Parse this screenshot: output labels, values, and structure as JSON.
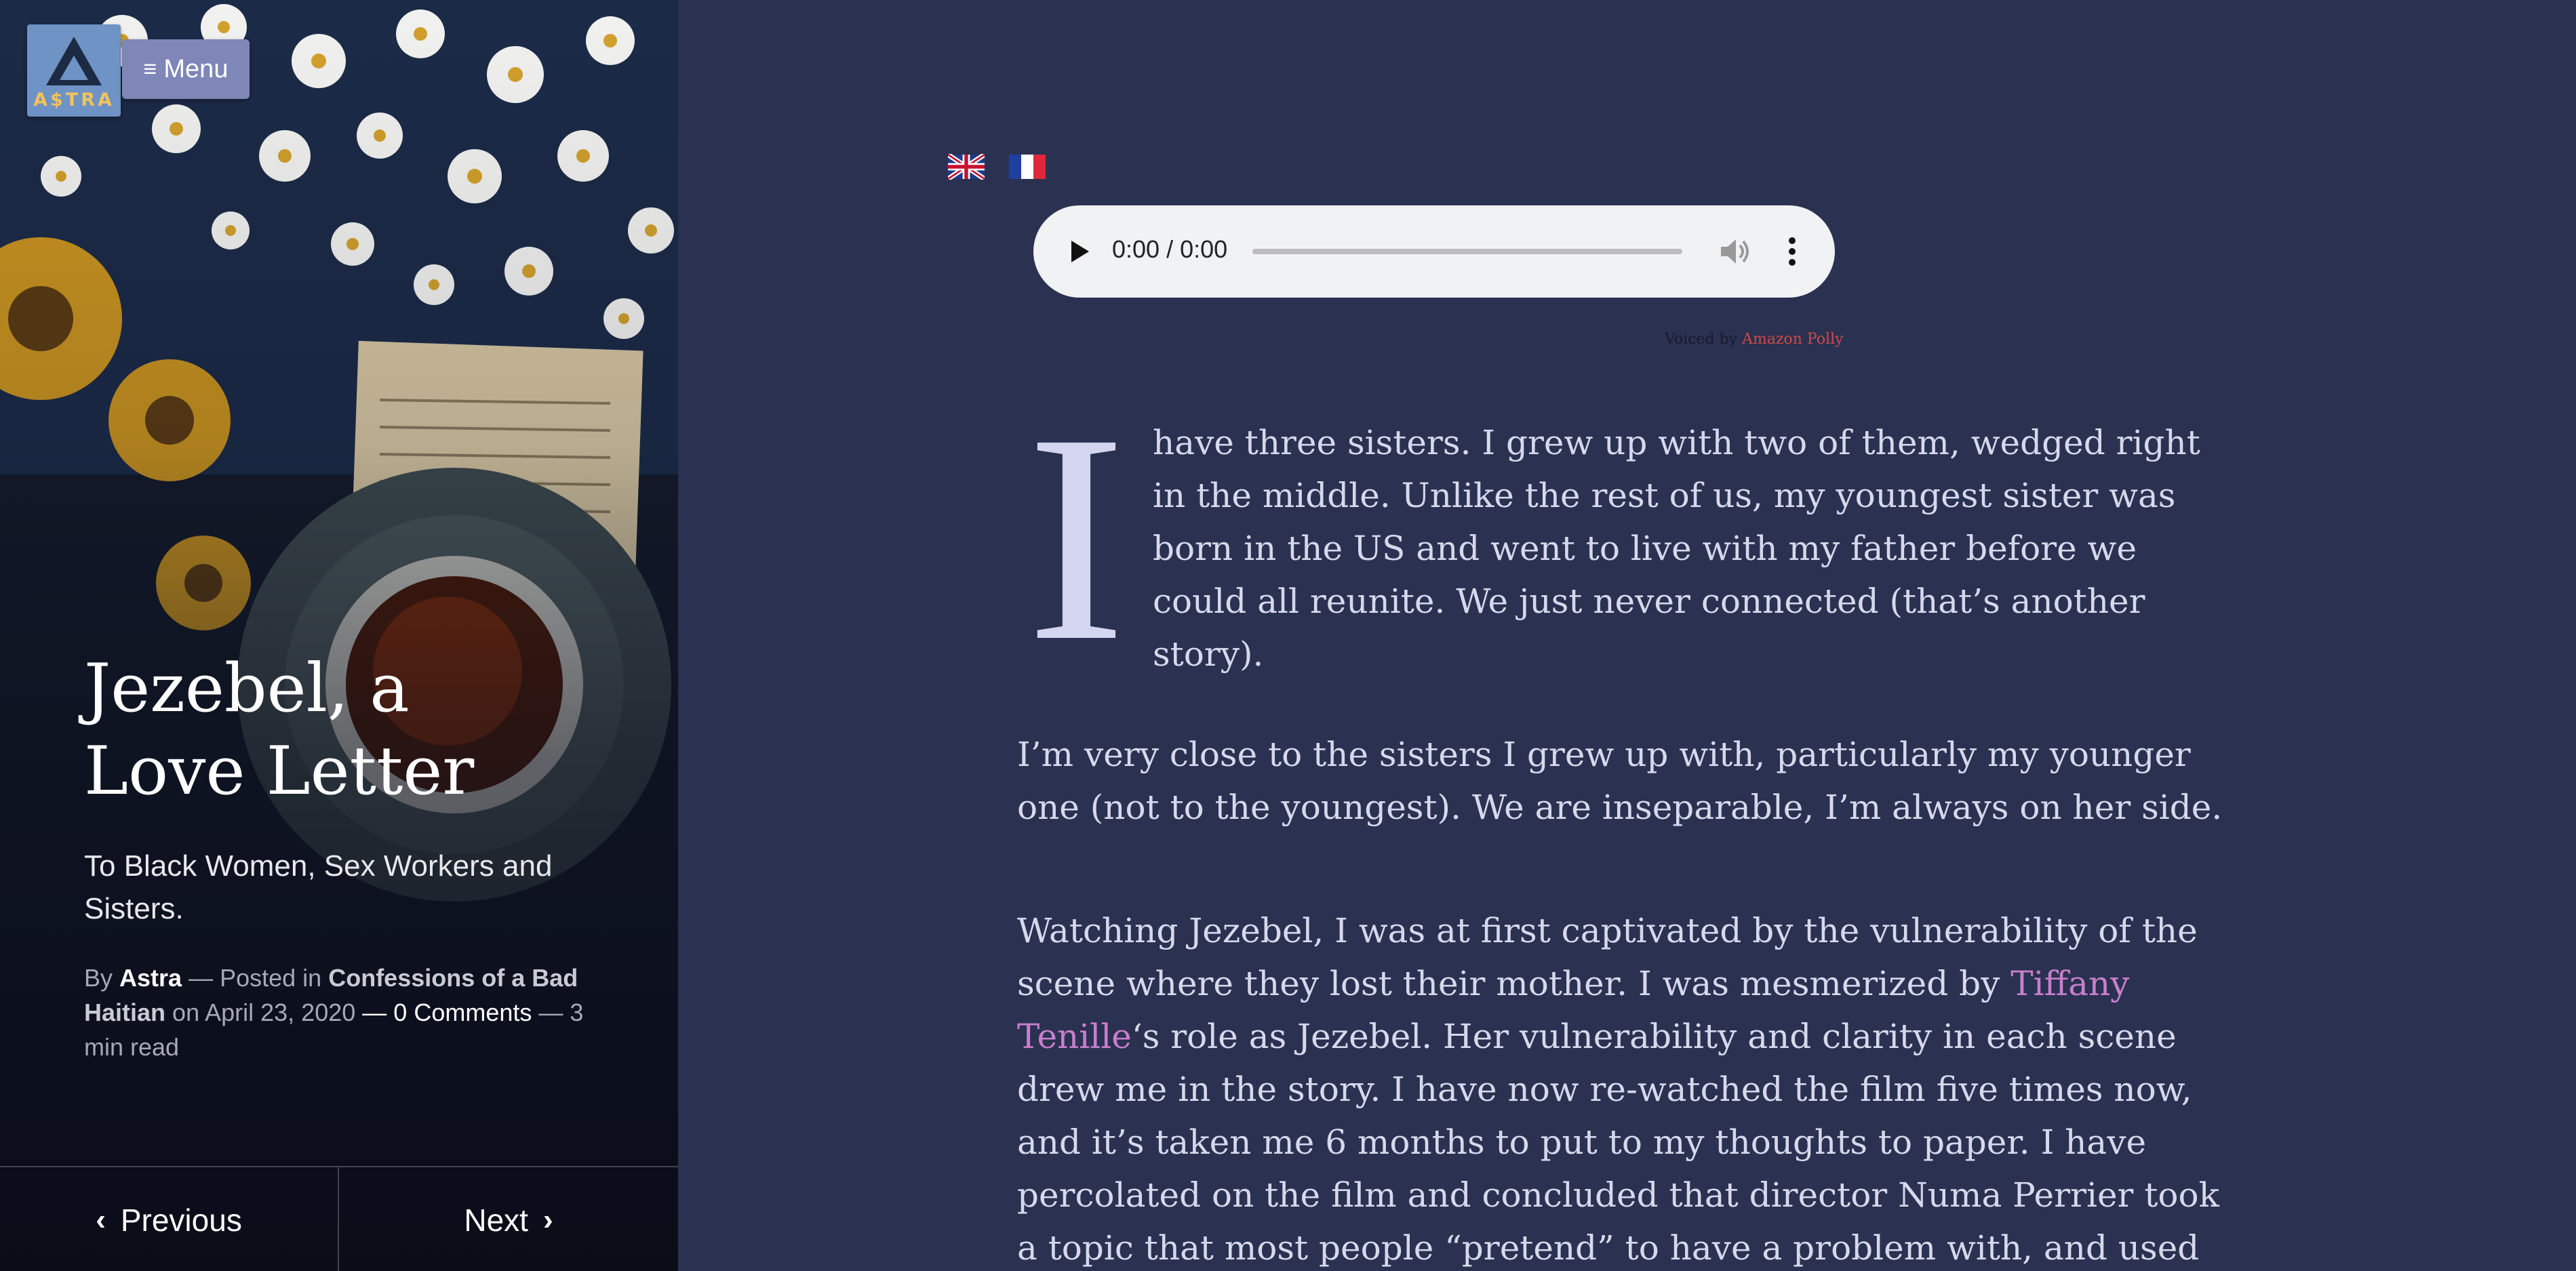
{
  "header": {
    "logo_text": "A$TRA",
    "menu_label": "Menu"
  },
  "post": {
    "title": "Jezebel, a Love Letter",
    "subtitle": "To Black Women, Sex Workers and Sisters.",
    "meta": {
      "by_label": "By",
      "author": "Astra",
      "posted_in_label": "— Posted in",
      "category": "Confessions of a Bad Haitian",
      "on_label": "on",
      "date": "April 23, 2020",
      "sep1": "—",
      "comments": "0 Comments",
      "sep2": "—",
      "read_time": "3 min read"
    }
  },
  "post_nav": {
    "previous_label": "Previous",
    "next_label": "Next"
  },
  "audio_player": {
    "time": "0:00 / 0:00",
    "voiced_by_label": "Voiced by",
    "voiced_by_service": "Amazon Polly"
  },
  "article": {
    "dropcap": "I",
    "p1": "have three sisters. I grew up with two of them, wedged right in the middle. Unlike the rest of us, my youngest sister was born in the US and went to live with my father before we could all reunite. We just never connected (that’s another story).",
    "p2": "I’m very close to the sisters I grew up with, particularly my younger one (not to the youngest).  We are inseparable, I’m always on her side.",
    "p3_before_link": "Watching Jezebel, I was at first captivated by the vulnerability of the scene where they lost their mother. I was mesmerized by ",
    "p3_link": "Tiffany Tenille",
    "p3_after_link": "‘s role as Jezebel. Her vulnerability and clarity in each scene drew me in the story. I have now re-watched the film five times now, and it’s taken me 6 months to put to my thoughts to paper. I have percolated on the film and concluded that director Numa Perrier took a topic that most people “pretend” to have a problem with, and used it to illuminate the bonds of sisterhood."
  },
  "colors": {
    "content_background": "#2b3150",
    "text": "#d6d9ec",
    "link": "#c77fcc",
    "menu_button": "#7f86b8",
    "logo_background": "#6e93c4",
    "polly_link": "#d04a4a"
  },
  "icons": {
    "logo": "astra-triangle-logo",
    "menu": "hamburger-icon",
    "previous": "chevron-left-icon",
    "next": "chevron-right-icon",
    "play": "play-icon",
    "volume": "volume-icon",
    "more": "more-vertical-icon",
    "flag_en": "uk-flag-icon",
    "flag_fr": "france-flag-icon"
  }
}
